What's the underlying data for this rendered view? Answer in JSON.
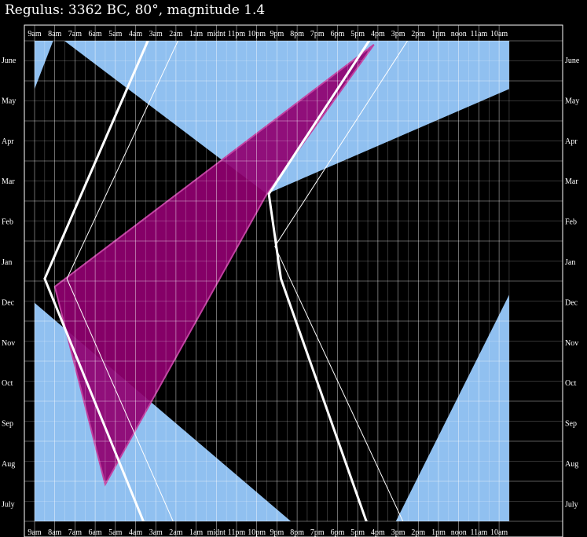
{
  "title": "Regulus: 3362 BC, 80°, magnitude 1.4",
  "colors": {
    "background": "#000000",
    "twilight": "#90c0f0",
    "visibility": "#900070",
    "visibility_edge": "#c040a0",
    "grid": "#ffffff",
    "curve": "#ffffff"
  },
  "chart_data": {
    "type": "area",
    "title": "Regulus: 3362 BC, 80°, magnitude 1.4",
    "x_ticks": [
      "9am",
      "8am",
      "7am",
      "6am",
      "5am",
      "4am",
      "3am",
      "2am",
      "1am",
      "midnt",
      "11pm",
      "10pm",
      "9pm",
      "8pm",
      "7pm",
      "6pm",
      "5pm",
      "4pm",
      "3pm",
      "2pm",
      "1pm",
      "noon",
      "11am",
      "10am"
    ],
    "y_ticks": [
      "June",
      "May",
      "Apr",
      "Mar",
      "Feb",
      "Jan",
      "Dec",
      "Nov",
      "Oct",
      "Sep",
      "Aug",
      "July"
    ],
    "x_range_hours": [
      9.0,
      -14.5
    ],
    "y_range_months": [
      0,
      12
    ],
    "grid": true,
    "daylight_regions": [
      {
        "name": "upper-left",
        "points": [
          [
            9.0,
            0.4
          ],
          [
            8.0,
            0.4
          ],
          [
            9.0,
            1.7
          ]
        ]
      },
      {
        "name": "upper-right",
        "points": [
          [
            7.8,
            0.4
          ],
          [
            -14.5,
            0.4
          ],
          [
            -14.5,
            1.7
          ],
          [
            -2.5,
            4.3
          ]
        ]
      },
      {
        "name": "lower-left",
        "points": [
          [
            9.0,
            7.0
          ],
          [
            -4.6,
            12.8
          ],
          [
            9.0,
            12.8
          ]
        ]
      },
      {
        "name": "lower-right",
        "points": [
          [
            -14.5,
            6.8
          ],
          [
            -14.5,
            12.8
          ],
          [
            -8.5,
            12.8
          ]
        ]
      }
    ],
    "star_visible_region": {
      "points": [
        [
          -7.8,
          0.6
        ],
        [
          -2.5,
          4.3
        ],
        [
          5.5,
          11.5
        ],
        [
          8.0,
          6.6
        ]
      ]
    },
    "curves": [
      {
        "name": "rise-heavy",
        "width": 3,
        "points": [
          [
            3.3,
            0.4
          ],
          [
            8.5,
            6.4
          ],
          [
            3.3,
            12.8
          ]
        ]
      },
      {
        "name": "rise-thin",
        "width": 1,
        "points": [
          [
            1.8,
            0.4
          ],
          [
            7.4,
            6.4
          ],
          [
            1.8,
            12.8
          ]
        ]
      },
      {
        "name": "set-heavy",
        "width": 3,
        "points": [
          [
            -7.7,
            0.4
          ],
          [
            -2.6,
            4.3
          ],
          [
            -3.2,
            6.4
          ],
          [
            -7.7,
            12.8
          ]
        ]
      },
      {
        "name": "set-thin",
        "width": 1,
        "points": [
          [
            -9.6,
            0.4
          ],
          [
            -2.9,
            5.6
          ],
          [
            -9.6,
            12.8
          ]
        ]
      }
    ]
  }
}
